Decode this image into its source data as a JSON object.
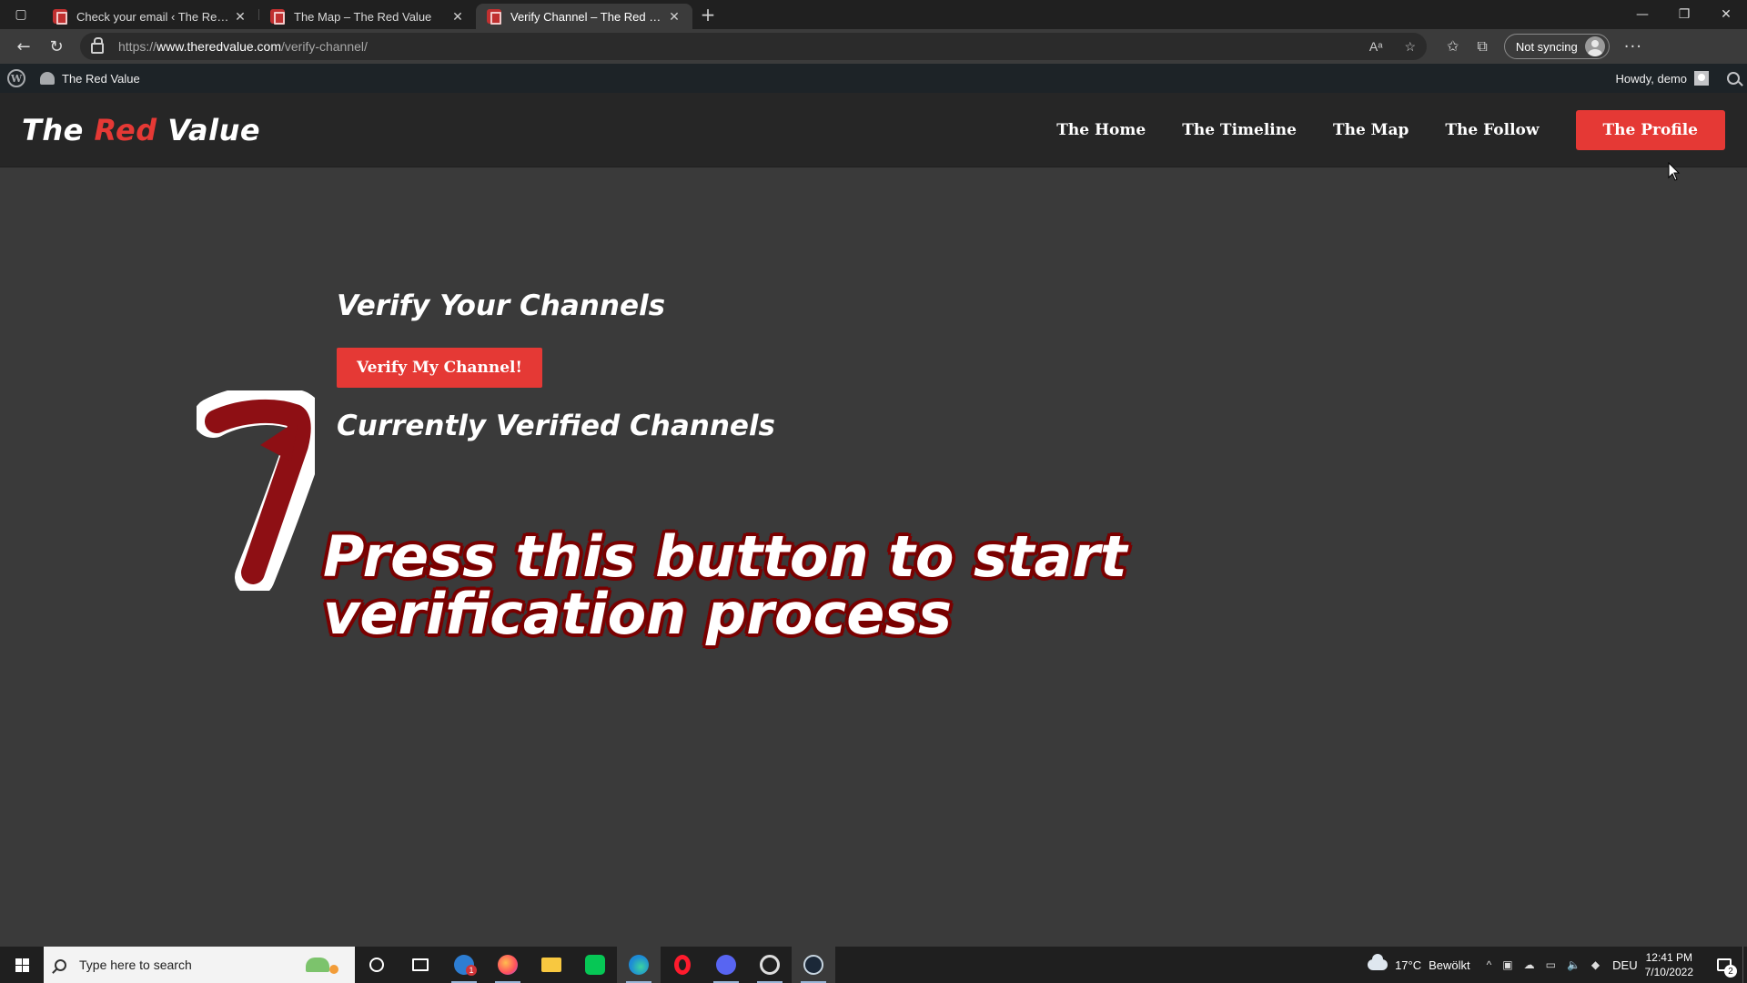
{
  "browser": {
    "tabs": [
      {
        "title": "Check your email ‹ The Red Value",
        "active": false
      },
      {
        "title": "The Map – The Red Value",
        "active": false
      },
      {
        "title": "Verify Channel – The Red Value",
        "active": true
      }
    ],
    "url": {
      "protocol": "https://",
      "host": "www.theredvalue.com",
      "path": "/verify-channel/"
    },
    "sync_label": "Not syncing"
  },
  "wp_admin_bar": {
    "site_name": "The Red Value",
    "greeting": "Howdy, demo"
  },
  "site": {
    "logo_parts": [
      "The ",
      "Red",
      " Value"
    ],
    "nav": [
      {
        "label": "The Home"
      },
      {
        "label": "The Timeline"
      },
      {
        "label": "The Map"
      },
      {
        "label": "The Follow"
      }
    ],
    "nav_cta": "The Profile",
    "accent_color": "#e53935"
  },
  "main": {
    "verify_heading": "Verify Your Channels",
    "verify_button": "Verify My Channel!",
    "current_heading": "Currently Verified Channels"
  },
  "overlay": {
    "step_number": "7",
    "line1": "Press this button to start",
    "line2": "verification process"
  },
  "taskbar": {
    "search_placeholder": "Type here to search",
    "mail_badge": "1",
    "weather_temp": "17°C",
    "weather_desc": "Bewölkt",
    "language": "DEU",
    "time": "12:41 PM",
    "date": "7/10/2022",
    "notification_count": "2"
  }
}
